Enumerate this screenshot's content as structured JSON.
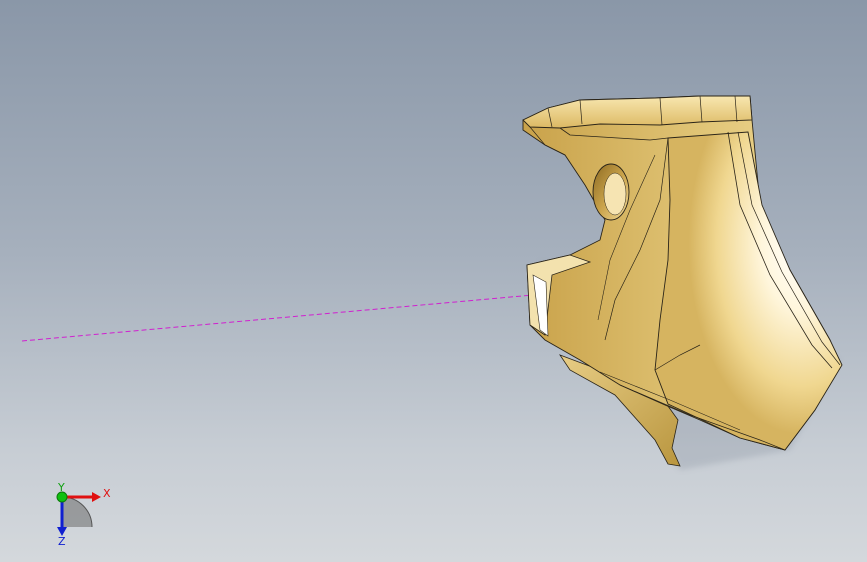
{
  "viewport": {
    "background_top": "#8a97a8",
    "background_bottom": "#d4d8dc"
  },
  "part": {
    "body_color": "#e2c779",
    "highlight_color": "#ffffff",
    "shadow_color": "#b8923c",
    "edge_color": "#2a2418"
  },
  "sketch_line": {
    "color": "#d020d0",
    "style": "dashed"
  },
  "triad": {
    "x_label": "X",
    "y_label": "Y",
    "z_label": "Z",
    "x_color": "#e01010",
    "y_color": "#10c010",
    "z_color": "#1020d0"
  }
}
